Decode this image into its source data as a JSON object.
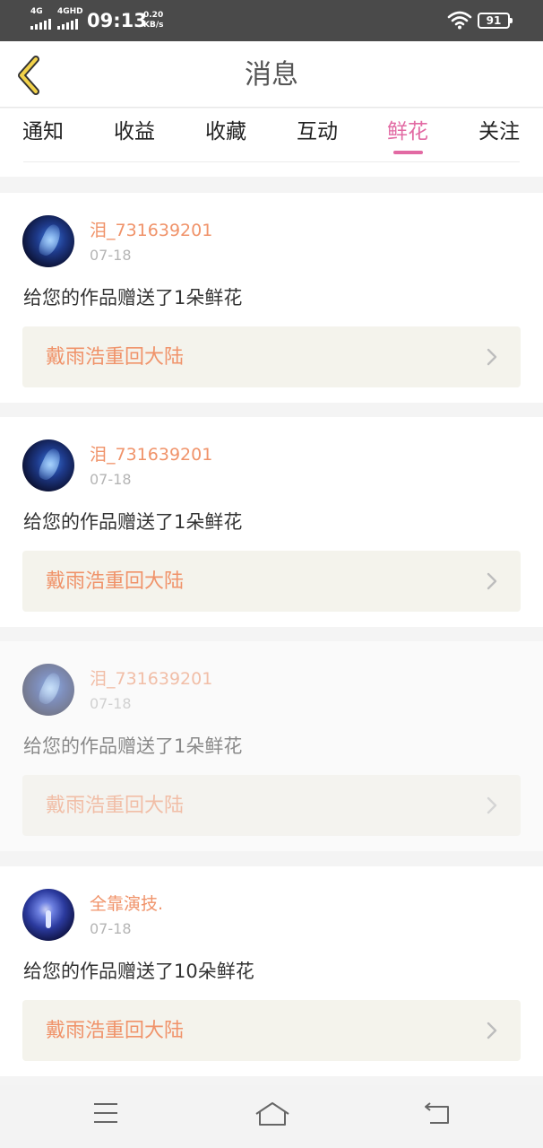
{
  "status_bar": {
    "sim1_label": "4G",
    "sim2_label": "4GHD",
    "time": "09:13",
    "net_speed_value": "0.20",
    "net_speed_unit": "KB/s",
    "battery": "91",
    "icons": [
      "signal-icon",
      "wifi-icon",
      "battery-icon"
    ]
  },
  "header": {
    "title": "消息",
    "back_icon": "chevron-left-icon"
  },
  "tabs": [
    {
      "label": "通知"
    },
    {
      "label": "收益"
    },
    {
      "label": "收藏"
    },
    {
      "label": "互动"
    },
    {
      "label": "鲜花",
      "active": true
    },
    {
      "label": "关注"
    }
  ],
  "messages": [
    {
      "user": "泪_731639201",
      "date": "07-18",
      "text": "给您的作品赠送了1朵鲜花",
      "work": "戴雨浩重回大陆"
    },
    {
      "user": "泪_731639201",
      "date": "07-18",
      "text": "给您的作品赠送了1朵鲜花",
      "work": "戴雨浩重回大陆"
    },
    {
      "user": "泪_731639201",
      "date": "07-18",
      "text": "给您的作品赠送了1朵鲜花",
      "work": "戴雨浩重回大陆"
    },
    {
      "user": "全靠演技.",
      "date": "07-18",
      "text": "给您的作品赠送了10朵鲜花",
      "work": "戴雨浩重回大陆"
    }
  ],
  "colors": {
    "accent_pink": "#e26aa3",
    "name_orange": "#f0936a",
    "work_bg": "#f4f3ec",
    "status_bar_bg": "#4a4a4a"
  },
  "nav_bar": {
    "icons": [
      "menu-icon",
      "home-icon",
      "back-icon"
    ]
  }
}
